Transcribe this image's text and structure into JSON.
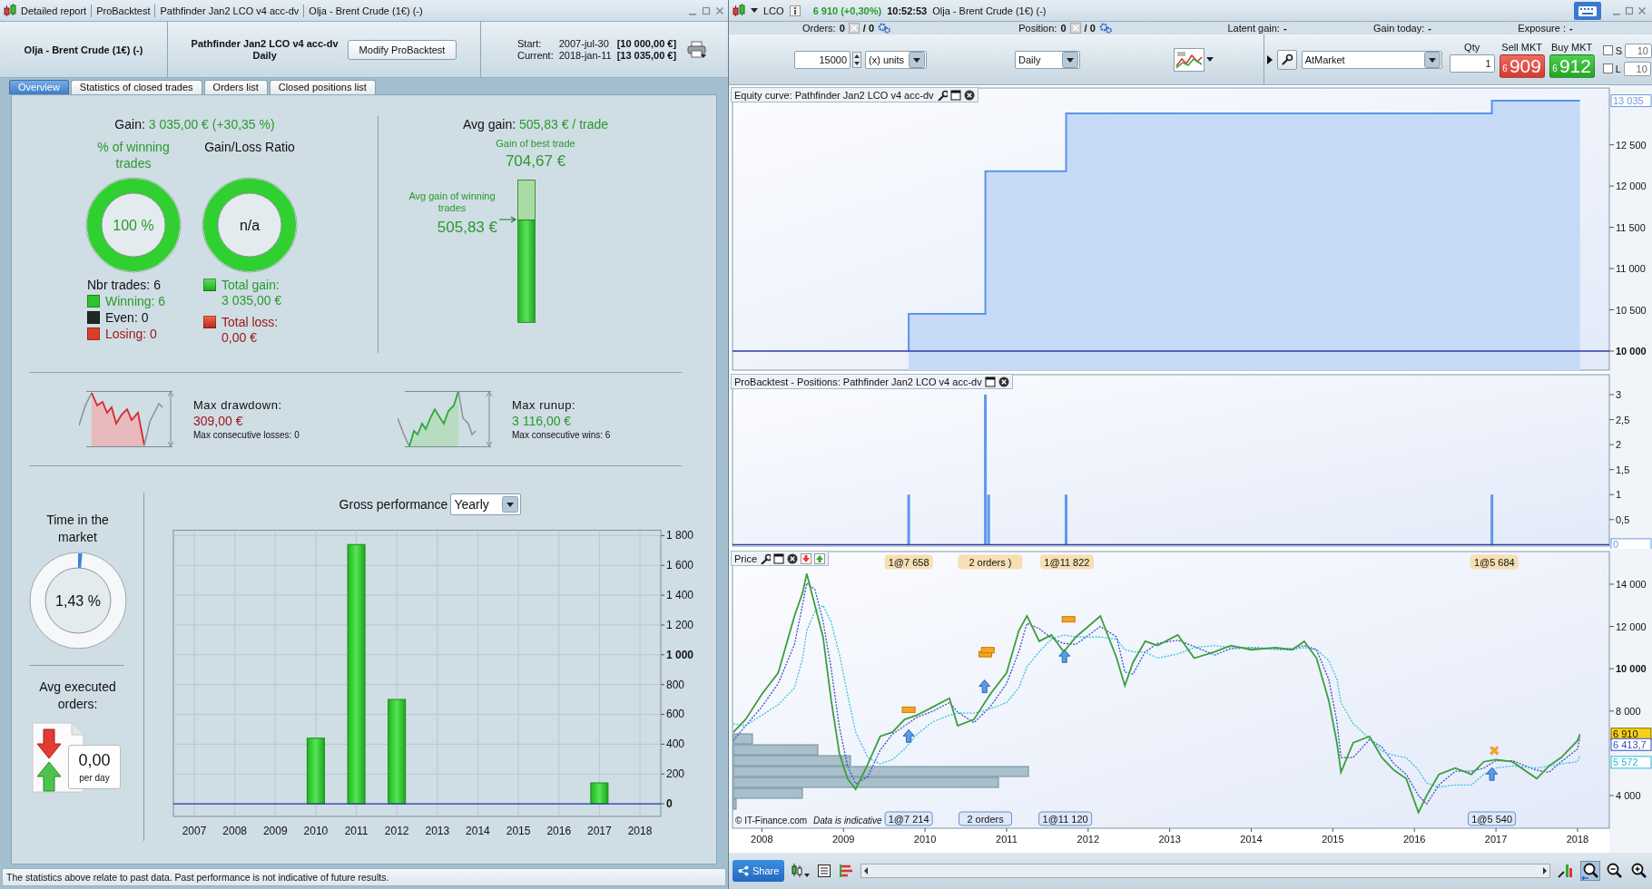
{
  "report_window": {
    "title_parts": [
      "Detailed report",
      "ProBacktest",
      "Pathfinder Jan2 LCO v4 acc-dv",
      "Olja - Brent Crude (1€) (-)"
    ],
    "instrument": "Olja - Brent Crude (1€) (-)",
    "strategy": "Pathfinder Jan2 LCO v4 acc-dv",
    "timeframe": "Daily",
    "modify_button": "Modify ProBacktest",
    "start": {
      "label": "Start:",
      "date": "2007-jul-30",
      "value": "[10 000,00 €]"
    },
    "current": {
      "label": "Current:",
      "date": "2018-jan-11",
      "value": "[13 035,00 €]"
    },
    "tabs": [
      {
        "label": "Overview",
        "selected": true
      },
      {
        "label": "Statistics of closed trades",
        "selected": false
      },
      {
        "label": "Orders list",
        "selected": false
      },
      {
        "label": "Closed positions list",
        "selected": false
      }
    ],
    "overview": {
      "gain": {
        "label": "Gain:",
        "value": "3 035,00 € (+30,35 %)"
      },
      "winning_ring": {
        "title": "% of winning trades",
        "value": "100 %",
        "level": 1
      },
      "ratio_ring": {
        "title": "Gain/Loss Ratio",
        "value": "n/a",
        "level": 1
      },
      "nbr_trades": "Nbr trades: 6",
      "legend": [
        {
          "kind": "winning",
          "text": "Winning: 6",
          "color": "#2ec42e"
        },
        {
          "kind": "even",
          "text": "Even: 0",
          "color": "#1e2a1e"
        },
        {
          "kind": "losing",
          "text": "Losing: 0",
          "color": "#d9402a"
        }
      ],
      "total_gain": {
        "label": "Total gain:",
        "value": "3 035,00 €"
      },
      "total_loss": {
        "label": "Total loss:",
        "value": "0,00 €"
      },
      "avg_gain": {
        "label": "Avg gain:",
        "value": "505,83 € / trade"
      },
      "best_trade": {
        "label": "Gain of best trade",
        "value": "704,67 €"
      },
      "avg_winning": {
        "label": "Avg gain of winning trades",
        "value": "505,83 €",
        "level": 0.72
      },
      "drawdown": {
        "label": "Max drawdown:",
        "value": "309,00 €",
        "note": "Max consecutive losses: 0"
      },
      "runup": {
        "label": "Max runup:",
        "value": "3 116,00 €",
        "note": "Max consecutive wins: 6"
      },
      "time_in_market": {
        "label": "Time in the market",
        "value": "1,43 %",
        "level": 0.0143
      },
      "avg_orders": {
        "label": "Avg executed orders:",
        "value": "0,00",
        "unit": "per day"
      },
      "gross_performance": {
        "period": "Yearly",
        "chart_data": {
          "type": "bar",
          "title": "Gross performance",
          "grid": true,
          "categories": [
            "2007",
            "2008",
            "2009",
            "2010",
            "2011",
            "2012",
            "2013",
            "2014",
            "2015",
            "2016",
            "2017",
            "2018"
          ],
          "values": [
            0,
            0,
            0,
            440,
            1740,
            700,
            0,
            0,
            0,
            0,
            140,
            0
          ],
          "ylim": [
            -85,
            1836
          ],
          "ref_lines": [
            {
              "axis": "y",
              "value": 0
            }
          ],
          "yticks": [
            {
              "value": 0,
              "label": "0"
            },
            {
              "value": 200,
              "label": "200"
            },
            {
              "value": 400,
              "label": "400"
            },
            {
              "value": 600,
              "label": "600"
            },
            {
              "value": 800,
              "label": "800"
            },
            {
              "value": 1000,
              "label": "1 000"
            },
            {
              "value": 1200,
              "label": "1 200"
            },
            {
              "value": 1400,
              "label": "1 400"
            },
            {
              "value": 1600,
              "label": "1 600"
            },
            {
              "value": 1800,
              "label": "1 800"
            }
          ]
        }
      }
    },
    "footer": "The statistics above relate to past data. Past performance is not indicative of future results."
  },
  "trading_window": {
    "symbol": "LCO",
    "last": "6 910 (+0,30%)",
    "time": "10:52:53",
    "name": "Olja - Brent Crude (1€) (-)",
    "stats": [
      {
        "kind": "orders",
        "label": "Orders:",
        "value": "0",
        "second": "/ 0"
      },
      {
        "kind": "orders",
        "label": "Position:",
        "value": "0",
        "second": "/ 0"
      },
      {
        "kind": "plain",
        "label": "Latent gain:",
        "value": "-"
      },
      {
        "kind": "plain",
        "label": "Gain today:",
        "value": "-"
      },
      {
        "kind": "plain",
        "label": "Exposure :",
        "value": "-"
      }
    ],
    "quantity": "15000",
    "unit": "(x) units",
    "period": "Daily",
    "order_type": "AtMarket",
    "qty": {
      "label": "Qty",
      "value": "1"
    },
    "sell": {
      "label": "Sell MKT",
      "small": "6",
      "big": "909"
    },
    "buy": {
      "label": "Buy MKT",
      "small": "6",
      "big": "912"
    },
    "limits": [
      {
        "label": "S",
        "checked": false,
        "value": "10"
      },
      {
        "label": "L",
        "checked": false,
        "value": "10"
      }
    ],
    "equity": {
      "value_tag": "13 035",
      "chart_data": {
        "type": "area",
        "title": "Equity curve: Pathfinder Jan2 LCO v4 acc-dv",
        "x": [
          2009.8,
          2009.8,
          2010.74,
          2010.74,
          2011.73,
          2011.73,
          2016.95,
          2016.95,
          2018.03
        ],
        "series": [
          {
            "color": "#5b93e8",
            "values": [
              10000,
              10450,
              10450,
              12180,
              12180,
              12880,
              12880,
              13035,
              13035
            ]
          }
        ],
        "xlim": [
          2007.64,
          2018.39
        ],
        "ylim": [
          9769,
          13189
        ],
        "ref_lines": [
          {
            "axis": "y",
            "value": 10000
          }
        ],
        "yticks": [
          {
            "value": 10000,
            "label": "10 000"
          },
          {
            "value": 10500,
            "label": "10 500"
          },
          {
            "value": 11000,
            "label": "11 000"
          },
          {
            "value": 11500,
            "label": "11 500"
          },
          {
            "value": 12000,
            "label": "12 000"
          },
          {
            "value": 12500,
            "label": "12 500"
          }
        ]
      }
    },
    "positions": {
      "value_tag": "0",
      "chart_data": {
        "type": "bar",
        "title": "ProBacktest - Positions: Pathfinder Jan2 LCO v4 acc-dv",
        "x": [
          2009.8,
          2010.74,
          2010.78,
          2011.73,
          2016.95
        ],
        "values": [
          1,
          3,
          1,
          1,
          1
        ],
        "xlim": [
          2007.64,
          2018.39
        ],
        "ylim": [
          -0.03,
          3.4
        ],
        "ref_lines": [
          {
            "axis": "y",
            "value": 0
          }
        ],
        "yticks": [
          {
            "value": 0.5,
            "label": "0,5"
          },
          {
            "value": 1,
            "label": "1"
          },
          {
            "value": 1.5,
            "label": "1,5"
          },
          {
            "value": 2,
            "label": "2"
          },
          {
            "value": 2.5,
            "label": "2,5"
          },
          {
            "value": 3,
            "label": "3"
          }
        ]
      }
    },
    "price": {
      "credit": "© IT-Finance.com",
      "disclaimer": "Data is indicative",
      "order_labels": [
        {
          "kind": "top",
          "text": "1@7 658"
        },
        {
          "kind": "top",
          "text": "2 orders )"
        },
        {
          "kind": "top",
          "text": "1@11 822"
        },
        {
          "kind": "top",
          "text": "1@5 684"
        },
        {
          "kind": "bottom",
          "text": "1@7 214"
        },
        {
          "kind": "bottom",
          "text": "2 orders"
        },
        {
          "kind": "bottom",
          "text": "1@11 120"
        },
        {
          "kind": "bottom",
          "text": "1@5 540"
        }
      ],
      "price_tags": [
        {
          "kind": "last",
          "text": "6 910"
        },
        {
          "kind": "slow",
          "text": "6 413,7"
        },
        {
          "kind": "fast",
          "text": "5 572"
        }
      ],
      "trade_marks": [
        {
          "kind": "order"
        },
        {
          "kind": "order"
        },
        {
          "kind": "order"
        },
        {
          "kind": "order"
        },
        {
          "kind": "entry"
        },
        {
          "kind": "entry"
        },
        {
          "kind": "entry"
        },
        {
          "kind": "entry"
        },
        {
          "kind": "exit"
        }
      ],
      "chart_data": {
        "type": "line",
        "title": "Price",
        "x": [
          2007.65,
          2007.8,
          2008.0,
          2008.2,
          2008.4,
          2008.5,
          2008.55,
          2008.65,
          2008.75,
          2008.85,
          2008.95,
          2009.05,
          2009.15,
          2009.3,
          2009.45,
          2009.6,
          2009.75,
          2009.9,
          2010.1,
          2010.3,
          2010.4,
          2010.6,
          2010.8,
          2011.0,
          2011.15,
          2011.25,
          2011.4,
          2011.55,
          2011.7,
          2011.85,
          2012.15,
          2012.35,
          2012.45,
          2012.55,
          2012.7,
          2012.85,
          2013.1,
          2013.3,
          2013.55,
          2013.75,
          2014.0,
          2014.3,
          2014.5,
          2014.65,
          2014.8,
          2014.95,
          2015.05,
          2015.1,
          2015.25,
          2015.45,
          2015.6,
          2015.75,
          2015.9,
          2016.05,
          2016.15,
          2016.3,
          2016.5,
          2016.7,
          2016.85,
          2017.0,
          2017.2,
          2017.5,
          2017.65,
          2017.8,
          2018.0,
          2018.03
        ],
        "series": [
          {
            "color": "#3d9e3d",
            "values": [
              7000,
              7600,
              8800,
              9800,
              12500,
              13600,
              14500,
              13000,
              11500,
              8500,
              6000,
              4800,
              4300,
              5500,
              6800,
              7000,
              7600,
              7800,
              8200,
              8600,
              7300,
              7600,
              8800,
              9800,
              11800,
              12500,
              11300,
              11600,
              10800,
              11500,
              12500,
              10500,
              9200,
              10300,
              11300,
              11100,
              11600,
              10500,
              10800,
              11100,
              10900,
              11000,
              10900,
              11300,
              10500,
              8500,
              6500,
              5100,
              6500,
              6800,
              5800,
              5200,
              4800,
              3200,
              4000,
              5000,
              5300,
              5000,
              5600,
              5700,
              5600,
              4800,
              5400,
              5800,
              6600,
              6910
            ]
          },
          {
            "color": "#3c4fc8",
            "line_style": "dashed",
            "values": [
              6600,
              7300,
              8200,
              9300,
              11150,
              13050,
              14050,
              13750,
              12250,
              10000,
              7250,
              5400,
              4550,
              4900,
              6150,
              6900,
              7300,
              7700,
              8000,
              8400,
              7950,
              7450,
              8200,
              9300,
              10800,
              12150,
              11900,
              11450,
              11200,
              11150,
              12000,
              11500,
              9850,
              9750,
              10800,
              11200,
              11350,
              11050,
              10650,
              10950,
              11000,
              10950,
              10950,
              11100,
              10900,
              9500,
              7500,
              5800,
              5800,
              6650,
              6300,
              5500,
              5000,
              4000,
              3600,
              4500,
              5150,
              5150,
              5300,
              5650,
              5650,
              5200,
              5100,
              5600,
              6200,
              6760
            ]
          },
          {
            "color": "#36c3dc",
            "line_style": "dashed",
            "values": [
              7400,
              7300,
              7800,
              8300,
              9100,
              10500,
              11800,
              12700,
              13000,
              12200,
              10700,
              8800,
              7000,
              5800,
              5500,
              5700,
              6200,
              6900,
              7500,
              7800,
              7900,
              7900,
              8100,
              8400,
              9100,
              10100,
              10800,
              11400,
              11600,
              11500,
              11500,
              11400,
              10900,
              10800,
              10800,
              10500,
              10700,
              11000,
              11100,
              11000,
              11000,
              10900,
              10900,
              11000,
              10900,
              10400,
              9500,
              8400,
              7400,
              6700,
              6100,
              5900,
              5800,
              5200,
              4600,
              4400,
              4500,
              4500,
              5000,
              5300,
              5400,
              5300,
              5400,
              5500,
              5600,
              5900
            ]
          }
        ],
        "xlim": [
          2007.64,
          2018.39
        ],
        "ylim": [
          2455,
          15545
        ],
        "xticks": [
          {
            "value": 2008,
            "label": "2008"
          },
          {
            "value": 2009,
            "label": "2009"
          },
          {
            "value": 2010,
            "label": "2010"
          },
          {
            "value": 2011,
            "label": "2011"
          },
          {
            "value": 2012,
            "label": "2012"
          },
          {
            "value": 2013,
            "label": "2013"
          },
          {
            "value": 2014,
            "label": "2014"
          },
          {
            "value": 2015,
            "label": "2015"
          },
          {
            "value": 2016,
            "label": "2016"
          },
          {
            "value": 2017,
            "label": "2017"
          },
          {
            "value": 2018,
            "label": "2018"
          }
        ],
        "yticks": [
          {
            "value": 4000,
            "label": "4 000"
          },
          {
            "value": 8000,
            "label": "8 000"
          },
          {
            "value": 10000,
            "label": "10 000"
          },
          {
            "value": 12000,
            "label": "12 000"
          },
          {
            "value": 14000,
            "label": "14 000"
          }
        ]
      }
    },
    "share_button": "Share"
  }
}
